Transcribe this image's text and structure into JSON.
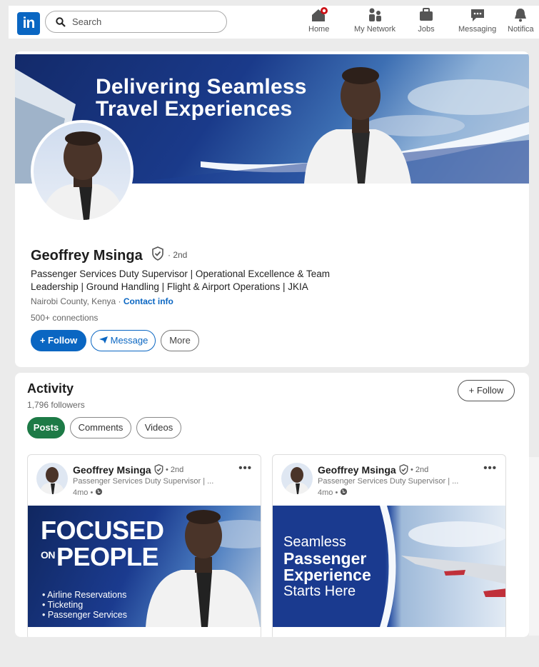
{
  "nav": {
    "logo": "in",
    "search_placeholder": "Search",
    "items": [
      {
        "label": "Home",
        "icon": "home-icon"
      },
      {
        "label": "My Network",
        "icon": "network-icon"
      },
      {
        "label": "Jobs",
        "icon": "briefcase-icon"
      },
      {
        "label": "Messaging",
        "icon": "chat-icon"
      },
      {
        "label": "Notifica",
        "icon": "bell-icon"
      }
    ]
  },
  "profile": {
    "banner_title_line1": "Delivering Seamless",
    "banner_title_line2": "Travel Experiences",
    "name": "Geoffrey Msinga",
    "degree": "· 2nd",
    "headline": "Passenger Services Duty Supervisor | Operational Excellence & Team Leadership | Ground Handling | Flight & Airport Operations | JKIA",
    "location": "Nairobi County, Kenya",
    "contact_info": "Contact info",
    "connections": "500+ connections",
    "buttons": {
      "follow": "+ Follow",
      "message": "Message",
      "more": "More"
    }
  },
  "activity": {
    "title": "Activity",
    "followers": "1,796 followers",
    "follow_button": "+ Follow",
    "filters": [
      "Posts",
      "Comments",
      "Videos"
    ],
    "posts": [
      {
        "author": "Geoffrey Msinga",
        "degree": "• 2nd",
        "subtitle": "Passenger Services Duty Supervisor | ...",
        "time": "4mo •",
        "image_text_line1": "FOCUSED",
        "image_text_on": "ON",
        "image_text_line2": "PEOPLE",
        "bullets": [
          "• Airline Reservations",
          "• Ticketing",
          "• Passenger Services"
        ]
      },
      {
        "author": "Geoffrey Msinga",
        "degree": "• 2nd",
        "subtitle": "Passenger Services Duty Supervisor | ...",
        "time": "4mo •",
        "image_lines": [
          "Seamless",
          "Passenger",
          "Experience",
          "Starts Here"
        ]
      }
    ]
  },
  "colors": {
    "brand": "#0a66c2",
    "posts_active": "#1d7a46",
    "banner_dark": "#132a6a"
  }
}
